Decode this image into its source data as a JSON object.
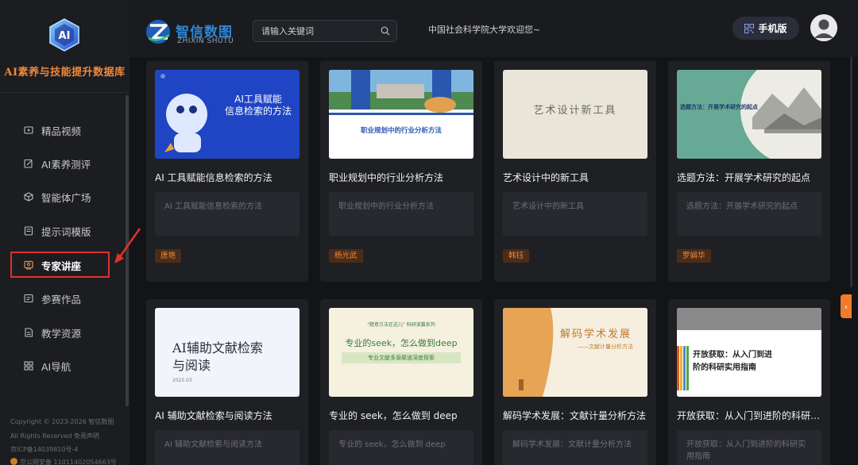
{
  "sidebar": {
    "logo_text": "AI",
    "brand_title": "AI素养与技能提升数据库",
    "items": [
      {
        "label": "精品视频",
        "icon": "play-icon"
      },
      {
        "label": "AI素养测评",
        "icon": "edit-icon"
      },
      {
        "label": "智能体广场",
        "icon": "cube-icon"
      },
      {
        "label": "提示词模版",
        "icon": "template-icon"
      },
      {
        "label": "专家讲座",
        "icon": "lecture-icon",
        "active": true
      },
      {
        "label": "参赛作品",
        "icon": "award-icon"
      },
      {
        "label": "教学资源",
        "icon": "document-icon"
      },
      {
        "label": "AI导航",
        "icon": "grid-icon"
      }
    ],
    "footer": {
      "copyright": "Copyright © 2023-2026 智信数图",
      "rights": "All Rights Reserved 免责声明",
      "icp": "京ICP备14039810号-4",
      "police": "京公网安备 11011402054663号"
    }
  },
  "header": {
    "logo_cn": "智信数图",
    "logo_en": "ZHIXIN SHUTU",
    "search_placeholder": "请输入关键词",
    "welcome": "中国社会科学院大学欢迎您~",
    "mobile_label": "手机版"
  },
  "thumb_texts": {
    "c1": "AI工具赋能\n信息检索的方法",
    "c1a": "AI工具赋能",
    "c1b": "信息检索的方法",
    "c2": "职业规划中的行业分析方法",
    "c3": "艺术设计新工具",
    "c4": "选题方法：开展学术研究的起点",
    "c5a": "AI辅助文献检索",
    "c5b": "与阅读",
    "c5c": "2025.03",
    "c6top": "\"题意方法在这儿\" 科研读篇系列",
    "c6a": "专业的seek，怎么做到deep",
    "c6b": "专业文献多源渠道深度探索",
    "c7a": "解码学术发展",
    "c7b": "——文献计量分析方法",
    "c8a": "开放获取：从入门到进",
    "c8b": "阶的科研实用指南"
  },
  "cards": [
    {
      "title": "AI 工具赋能信息检索的方法",
      "desc": "AI 工具赋能信息检索的方法",
      "tag": "唐艳"
    },
    {
      "title": "职业规划中的行业分析方法",
      "desc": "职业规划中的行业分析方法",
      "tag": "杨光武"
    },
    {
      "title": "艺术设计中的新工具",
      "desc": "艺术设计中的新工具",
      "tag": "韩钰"
    },
    {
      "title": "选题方法：开展学术研究的起点",
      "desc": "选题方法：开展学术研究的起点",
      "tag": "罗娟华"
    },
    {
      "title": "AI 辅助文献检索与阅读方法",
      "desc": "AI 辅助文献检索与阅读方法",
      "tag": ""
    },
    {
      "title": "专业的 seek，怎么做到 deep",
      "desc": "专业的 seek，怎么做到 deep",
      "tag": ""
    },
    {
      "title": "解码学术发展：文献计量分析方法",
      "desc": "解码学术发展：文献计量分析方法",
      "tag": ""
    },
    {
      "title": "开放获取：从入门到进阶的科研实用指南",
      "desc": "开放获取：从入门到进阶的科研实用指南",
      "tag": ""
    }
  ],
  "colors": {
    "accent": "#f08a3c",
    "highlight": "#e0312b",
    "brand_blue": "#2f86d8"
  }
}
